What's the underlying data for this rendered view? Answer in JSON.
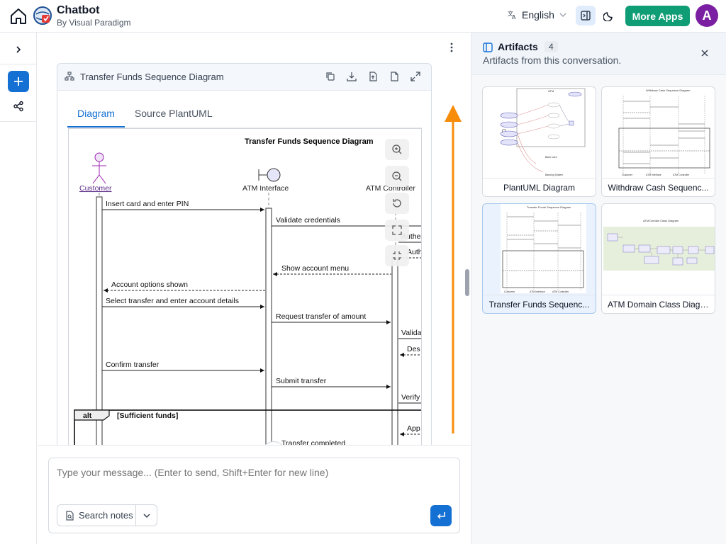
{
  "header": {
    "app_title": "Chatbot",
    "app_subtitle": "By Visual Paradigm",
    "language": "English",
    "more_apps_label": "More Apps",
    "avatar_initial": "A"
  },
  "card": {
    "title": "Transfer Funds Sequence Diagram",
    "tabs": [
      {
        "label": "Diagram",
        "active": true
      },
      {
        "label": "Source PlantUML",
        "active": false
      }
    ]
  },
  "diagram": {
    "title": "Transfer Funds Sequence Diagram",
    "participants": [
      "Customer",
      "ATM Interface",
      "ATM Controller"
    ],
    "messages": [
      "Insert card and enter PIN",
      "Validate credentials",
      "Authe",
      "Auth",
      "Show account menu",
      "Account options shown",
      "Select transfer and enter account details",
      "Request transfer of amount",
      "Valida",
      "Des",
      "Confirm transfer",
      "Submit transfer",
      "Verify",
      "App",
      "Transfer completed"
    ],
    "fragment_keyword": "alt",
    "fragment_guard": "[Sufficient funds]"
  },
  "composer": {
    "placeholder": "Type your message... (Enter to send, Shift+Enter for new line)",
    "search_notes_label": "Search notes"
  },
  "artifacts": {
    "title": "Artifacts",
    "count": "4",
    "subtitle": "Artifacts from this conversation.",
    "items": [
      {
        "label": "PlantUML Diagram",
        "selected": false
      },
      {
        "label": "Withdraw Cash Sequenc...",
        "selected": false
      },
      {
        "label": "Transfer Funds Sequenc...",
        "selected": true
      },
      {
        "label": "ATM Domain Class Diagr...",
        "selected": false
      }
    ]
  },
  "colors": {
    "accent_blue": "#1570d4",
    "more_apps_green": "#0f9d76",
    "avatar_purple": "#7b1fa2",
    "annotation_arrow": "#f78c0b"
  }
}
